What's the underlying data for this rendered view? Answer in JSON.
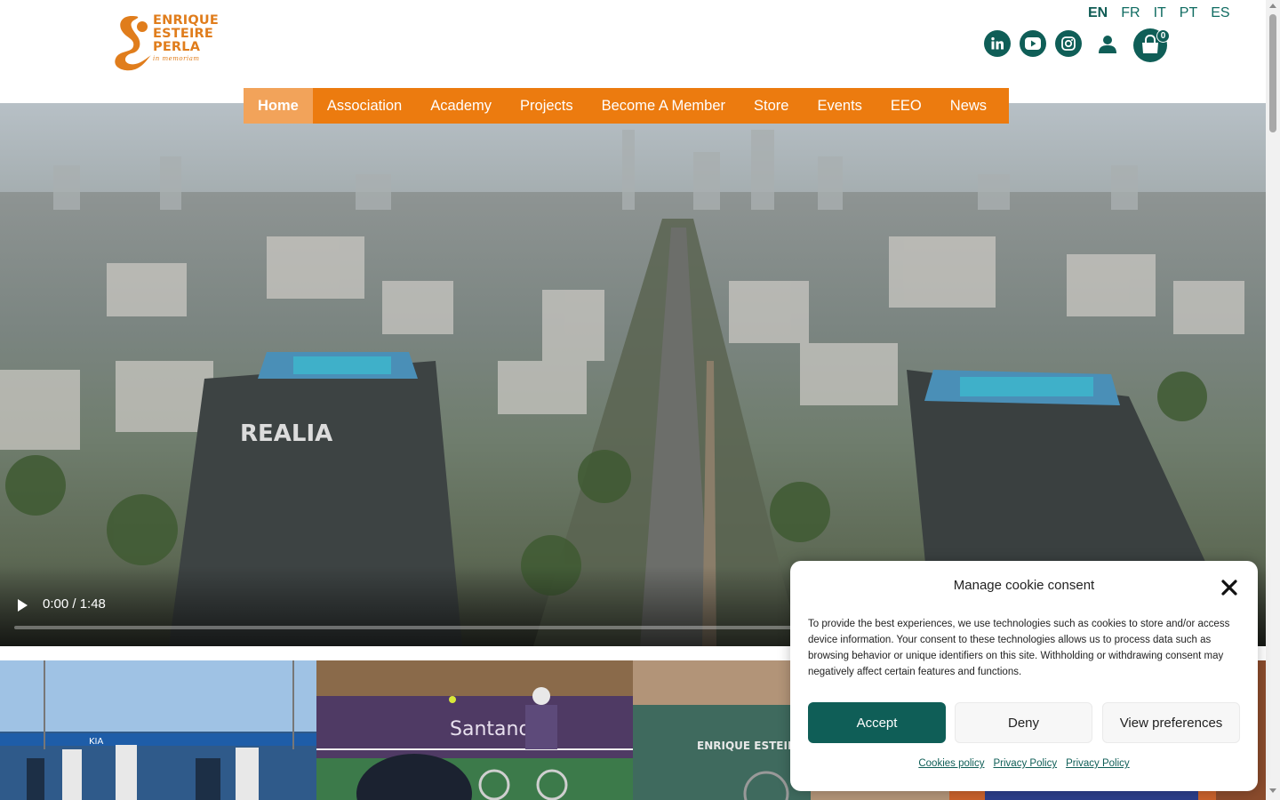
{
  "logo": {
    "line1": "ENRIQUE",
    "line2": "ESTEIRE",
    "line3": "PERLA",
    "tagline": "in memoriam",
    "color": "#e07d1c"
  },
  "languages": [
    {
      "label": "EN",
      "active": true
    },
    {
      "label": "FR",
      "active": false
    },
    {
      "label": "IT",
      "active": false
    },
    {
      "label": "PT",
      "active": false
    },
    {
      "label": "ES",
      "active": false
    }
  ],
  "header_icons": [
    "linkedin-icon",
    "youtube-icon",
    "instagram-icon",
    "user-icon",
    "cart-icon"
  ],
  "cart": {
    "count": "0"
  },
  "nav": {
    "items": [
      {
        "label": "Home",
        "active": true
      },
      {
        "label": "Association",
        "active": false
      },
      {
        "label": "Academy",
        "active": false
      },
      {
        "label": "Projects",
        "active": false
      },
      {
        "label": "Become A Member",
        "active": false
      },
      {
        "label": "Store",
        "active": false
      },
      {
        "label": "Events",
        "active": false
      },
      {
        "label": "EEO",
        "active": false
      },
      {
        "label": "News",
        "active": false
      }
    ],
    "bg_color": "#ec7b0f",
    "active_color": "#f2a35a"
  },
  "video": {
    "time": "0:00 / 1:48",
    "progress": 0,
    "building_sign": "REALIA"
  },
  "thumbnails": [
    {
      "name": "thumb-1",
      "text": "KIA"
    },
    {
      "name": "thumb-2",
      "text": "Santand"
    },
    {
      "name": "thumb-3",
      "text": "ENRIQUE ESTEIRE OPEN"
    },
    {
      "name": "thumb-4",
      "text": ""
    }
  ],
  "cookie": {
    "title": "Manage cookie consent",
    "body": "To provide the best experiences, we use technologies such as cookies to store and/or access device information. Your consent to these technologies allows us to process data such as browsing behavior or unique identifiers on this site. Withholding or withdrawing consent may negatively affect certain features and functions.",
    "accept": "Accept",
    "deny": "Deny",
    "preferences": "View preferences",
    "links": [
      "Cookies policy",
      "Privacy Policy",
      "Privacy Policy"
    ],
    "accent": "#0f5e57"
  }
}
